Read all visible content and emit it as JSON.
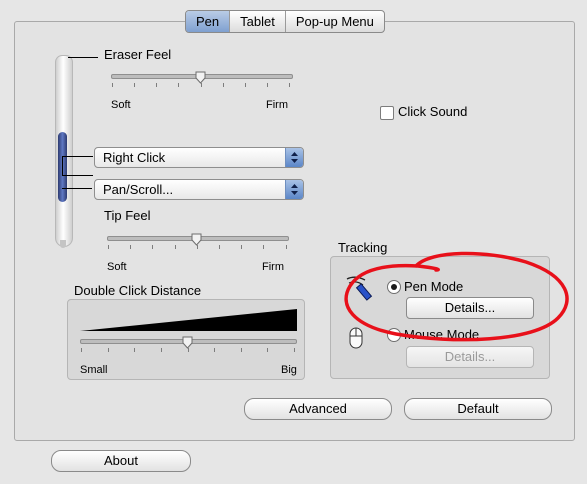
{
  "tabs": [
    "Pen",
    "Tablet",
    "Pop-up Menu"
  ],
  "eraser": {
    "label": "Eraser Feel",
    "min": "Soft",
    "max": "Firm",
    "value": 0.5
  },
  "click_sound": {
    "label": "Click Sound",
    "checked": false
  },
  "side_switch": {
    "upper": "Right Click",
    "lower": "Pan/Scroll..."
  },
  "tip": {
    "label": "Tip Feel",
    "min": "Soft",
    "max": "Firm",
    "value": 0.5
  },
  "double_click": {
    "label": "Double Click Distance",
    "min": "Small",
    "max": "Big",
    "value": 0.5
  },
  "tracking": {
    "label": "Tracking",
    "pen_mode": "Pen Mode",
    "pen_details": "Details...",
    "mouse_mode": "Mouse Mode",
    "mouse_details": "Details...",
    "selected": "pen"
  },
  "buttons": {
    "advanced": "Advanced",
    "default": "Default",
    "about": "About"
  },
  "colors": {
    "annotation": "#e8101a",
    "tab_active": "#8aa8d6"
  }
}
